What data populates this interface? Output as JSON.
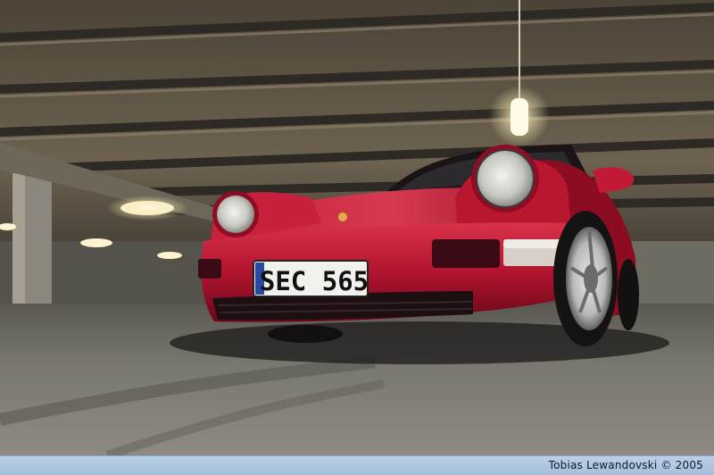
{
  "scene": {
    "plate_text": "SEC 565",
    "colors": {
      "car_body": "#b01530",
      "car_highlight": "#e0404f",
      "car_shadow": "#5a0512",
      "ceiling": "#6b6150",
      "floor": "#7b7872",
      "lamp": "#fffbe6",
      "credit_bar": "#b4c8e2"
    }
  },
  "credit": {
    "text": "Tobias Lewandovski © 2005"
  }
}
